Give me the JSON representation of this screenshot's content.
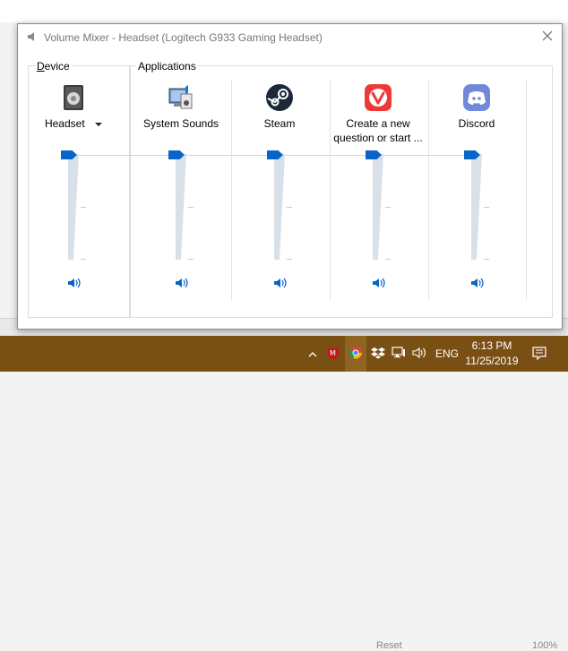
{
  "window": {
    "title": "Volume Mixer - Headset (Logitech G933 Gaming Headset)",
    "title_icon": "speaker-icon",
    "close_icon": "close-icon"
  },
  "device": {
    "group_label": "Device",
    "name": "Headset",
    "icon": "headset-device-icon",
    "dropdown_icon": "chevron-down-icon",
    "volume_percent": 100
  },
  "applications": {
    "group_label": "Applications",
    "items": [
      {
        "label": "System Sounds",
        "label2": "",
        "icon": "system-sounds-icon",
        "volume_percent": 100
      },
      {
        "label": "Steam",
        "label2": "",
        "icon": "steam-icon",
        "volume_percent": 100
      },
      {
        "label": "Create a new",
        "label2": "question or start ...",
        "icon": "vivaldi-icon",
        "volume_percent": 100
      },
      {
        "label": "Discord",
        "label2": "",
        "icon": "discord-icon",
        "volume_percent": 100
      }
    ]
  },
  "background": {
    "reset_label": "Reset",
    "zoom_label": "100%"
  },
  "taskbar": {
    "language": "ENG",
    "time": "6:13 PM",
    "date": "11/25/2019",
    "icons": [
      "chevron-up-icon",
      "mcafee-icon",
      "chrome-icon",
      "dropbox-icon",
      "network-icon",
      "volume-icon",
      "notification-icon"
    ]
  },
  "colors": {
    "accent": "#0a64c8",
    "taskbar": "#7a4f14",
    "track": "#d9e1e8"
  }
}
